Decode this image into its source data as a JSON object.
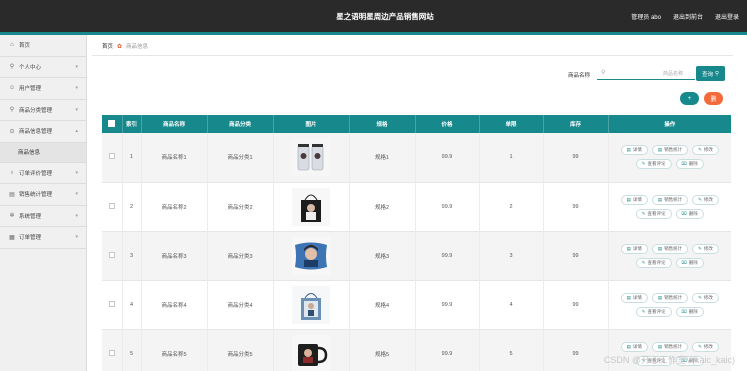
{
  "header": {
    "title": "星之语明星周边产品销售网站",
    "admin_label": "管理员 abo",
    "backend_label": "退出到前台",
    "logout_label": "退出登录",
    "accent_color": "#17888b"
  },
  "sidebar": {
    "items": [
      {
        "label": "首页",
        "icon": "home-icon",
        "glyph": "⌂"
      },
      {
        "label": "个人中心",
        "icon": "person-icon",
        "glyph": "⚲"
      },
      {
        "label": "用户管理",
        "icon": "users-icon",
        "glyph": "☺"
      },
      {
        "label": "商品分类管理",
        "icon": "person-icon",
        "glyph": "⚲"
      },
      {
        "label": "商品信息管理",
        "icon": "location-icon",
        "glyph": "⊙"
      },
      {
        "label": "商品信息",
        "icon": "",
        "glyph": ""
      },
      {
        "label": "订单评价管理",
        "icon": "pin-icon",
        "glyph": "♁"
      },
      {
        "label": "销售统计管理",
        "icon": "chart-icon",
        "glyph": "▤"
      },
      {
        "label": "系统管理",
        "icon": "gear-icon",
        "glyph": "✲"
      },
      {
        "label": "订单管理",
        "icon": "grid-icon",
        "glyph": "▦"
      }
    ]
  },
  "breadcrumb": {
    "home": "首页",
    "current": "商品信息"
  },
  "search": {
    "label": "商品名称",
    "placeholder": "商品名称",
    "button": "查询"
  },
  "actions": {
    "add": "+",
    "delete": "删"
  },
  "table": {
    "headers": [
      "",
      "索引",
      "商品名称",
      "商品分类",
      "图片",
      "规格",
      "价格",
      "单限",
      "库存",
      "操作"
    ],
    "rows": [
      {
        "index": "1",
        "name": "商品名称1",
        "category": "商品分类1",
        "image": "cup-image",
        "spec": "规格1",
        "price": "99.9",
        "limit": "1",
        "stock": "99"
      },
      {
        "index": "2",
        "name": "商品名称2",
        "category": "商品分类2",
        "image": "tote-bag-image",
        "spec": "规格2",
        "price": "99.9",
        "limit": "2",
        "stock": "99"
      },
      {
        "index": "3",
        "name": "商品名称3",
        "category": "商品分类3",
        "image": "pillow-image",
        "spec": "规格3",
        "price": "99.9",
        "limit": "3",
        "stock": "99"
      },
      {
        "index": "4",
        "name": "商品名称4",
        "category": "商品分类4",
        "image": "blue-bag-image",
        "spec": "规格4",
        "price": "99.9",
        "limit": "4",
        "stock": "99"
      },
      {
        "index": "5",
        "name": "商品名称5",
        "category": "商品分类5",
        "image": "mug-image",
        "spec": "规格5",
        "price": "99.9",
        "limit": "5",
        "stock": "99"
      }
    ],
    "ops": {
      "detail": "详情",
      "stats": "销售统计",
      "edit": "修改",
      "review": "查看评论",
      "delete": "删除"
    }
  },
  "watermark": "CSDN @开心工作室V(kaic_kaic)"
}
